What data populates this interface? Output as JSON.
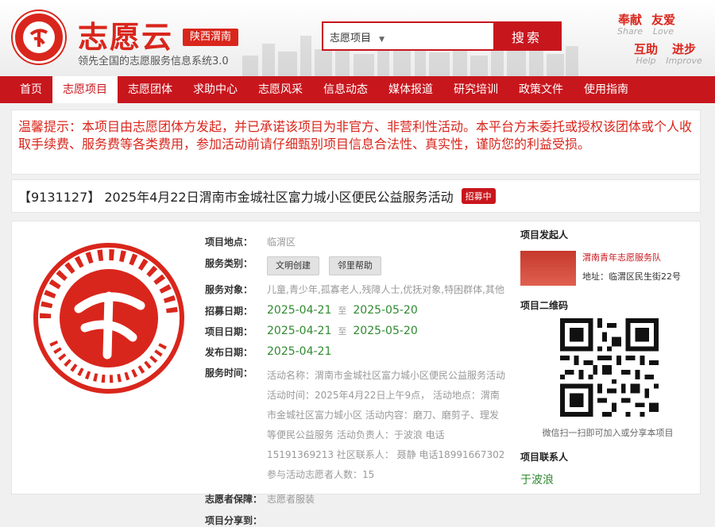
{
  "header": {
    "logo_text": "志愿云",
    "region": "陕西渭南",
    "slogan": "领先全国的志愿服务信息系统3.0",
    "search": {
      "select_value": "志愿项目",
      "placeholder": "",
      "button": "搜索"
    },
    "links": [
      {
        "cn": "奉献",
        "en": "Share"
      },
      {
        "cn": "友爱",
        "en": "Love"
      },
      {
        "cn": "互助",
        "en": "Help"
      },
      {
        "cn": "进步",
        "en": "Improve"
      }
    ]
  },
  "nav": {
    "items": [
      "首页",
      "志愿项目",
      "志愿团体",
      "求助中心",
      "志愿风采",
      "信息动态",
      "媒体报道",
      "研究培训",
      "政策文件",
      "使用指南"
    ],
    "active_index": 1
  },
  "notice": "温馨提示：本项目由志愿团体方发起，并已承诺该项目为非官方、非营利性活动。本平台方未委托或授权该团体或个人收取手续费、服务费等各类费用，参加活动前请仔细甄别项目信息合法性、真实性，谨防您的利益受损。",
  "project": {
    "title": "【9131127】 2025年4月22日渭南市金城社区富力城小区便民公益服务活动",
    "status_badge": "招募中",
    "labels": {
      "location": "项目地点：",
      "category": "服务类别：",
      "targets": "服务对象：",
      "recruit": "招募日期：",
      "project_date": "项目日期：",
      "publish": "发布日期：",
      "service_time": "服务时间：",
      "guarantee": "志愿者保障：",
      "share": "项目分享到："
    },
    "location": "临渭区",
    "categories": [
      "文明创建",
      "邻里帮助"
    ],
    "targets": "儿童,青少年,孤寡老人,残障人士,优抚对象,特困群体,其他",
    "recruit_start": "2025-04-21",
    "recruit_end": "2025-05-20",
    "project_start": "2025-04-21",
    "project_end": "2025-05-20",
    "to_word": "至",
    "publish_date": "2025-04-21",
    "service_time": "活动名称：渭南市金城社区富力城小区便民公益服务活动 活动时间：2025年4月22日上午9点， 活动地点：渭南市金城社区富力城小区 活动内容：磨刀、磨剪子、理发等便民公益服务 活动负责人：于波浪 电话15191369213 社区联系人： 聂静 电话18991667302 参与活动志愿者人数：15",
    "guarantee": "志愿者服装"
  },
  "sidebar": {
    "initiator_title": "项目发起人",
    "org_name": "渭南青年志愿服务队",
    "org_address": "地址：临渭区民生街22号",
    "qr_title": "项目二维码",
    "qr_caption": "微信扫一扫即可加入或分享本项目",
    "contact_title": "项目联系人",
    "contact_name": "于波浪"
  },
  "colors": {
    "brand_red": "#c8161d",
    "date_green": "#2f8a2f"
  }
}
